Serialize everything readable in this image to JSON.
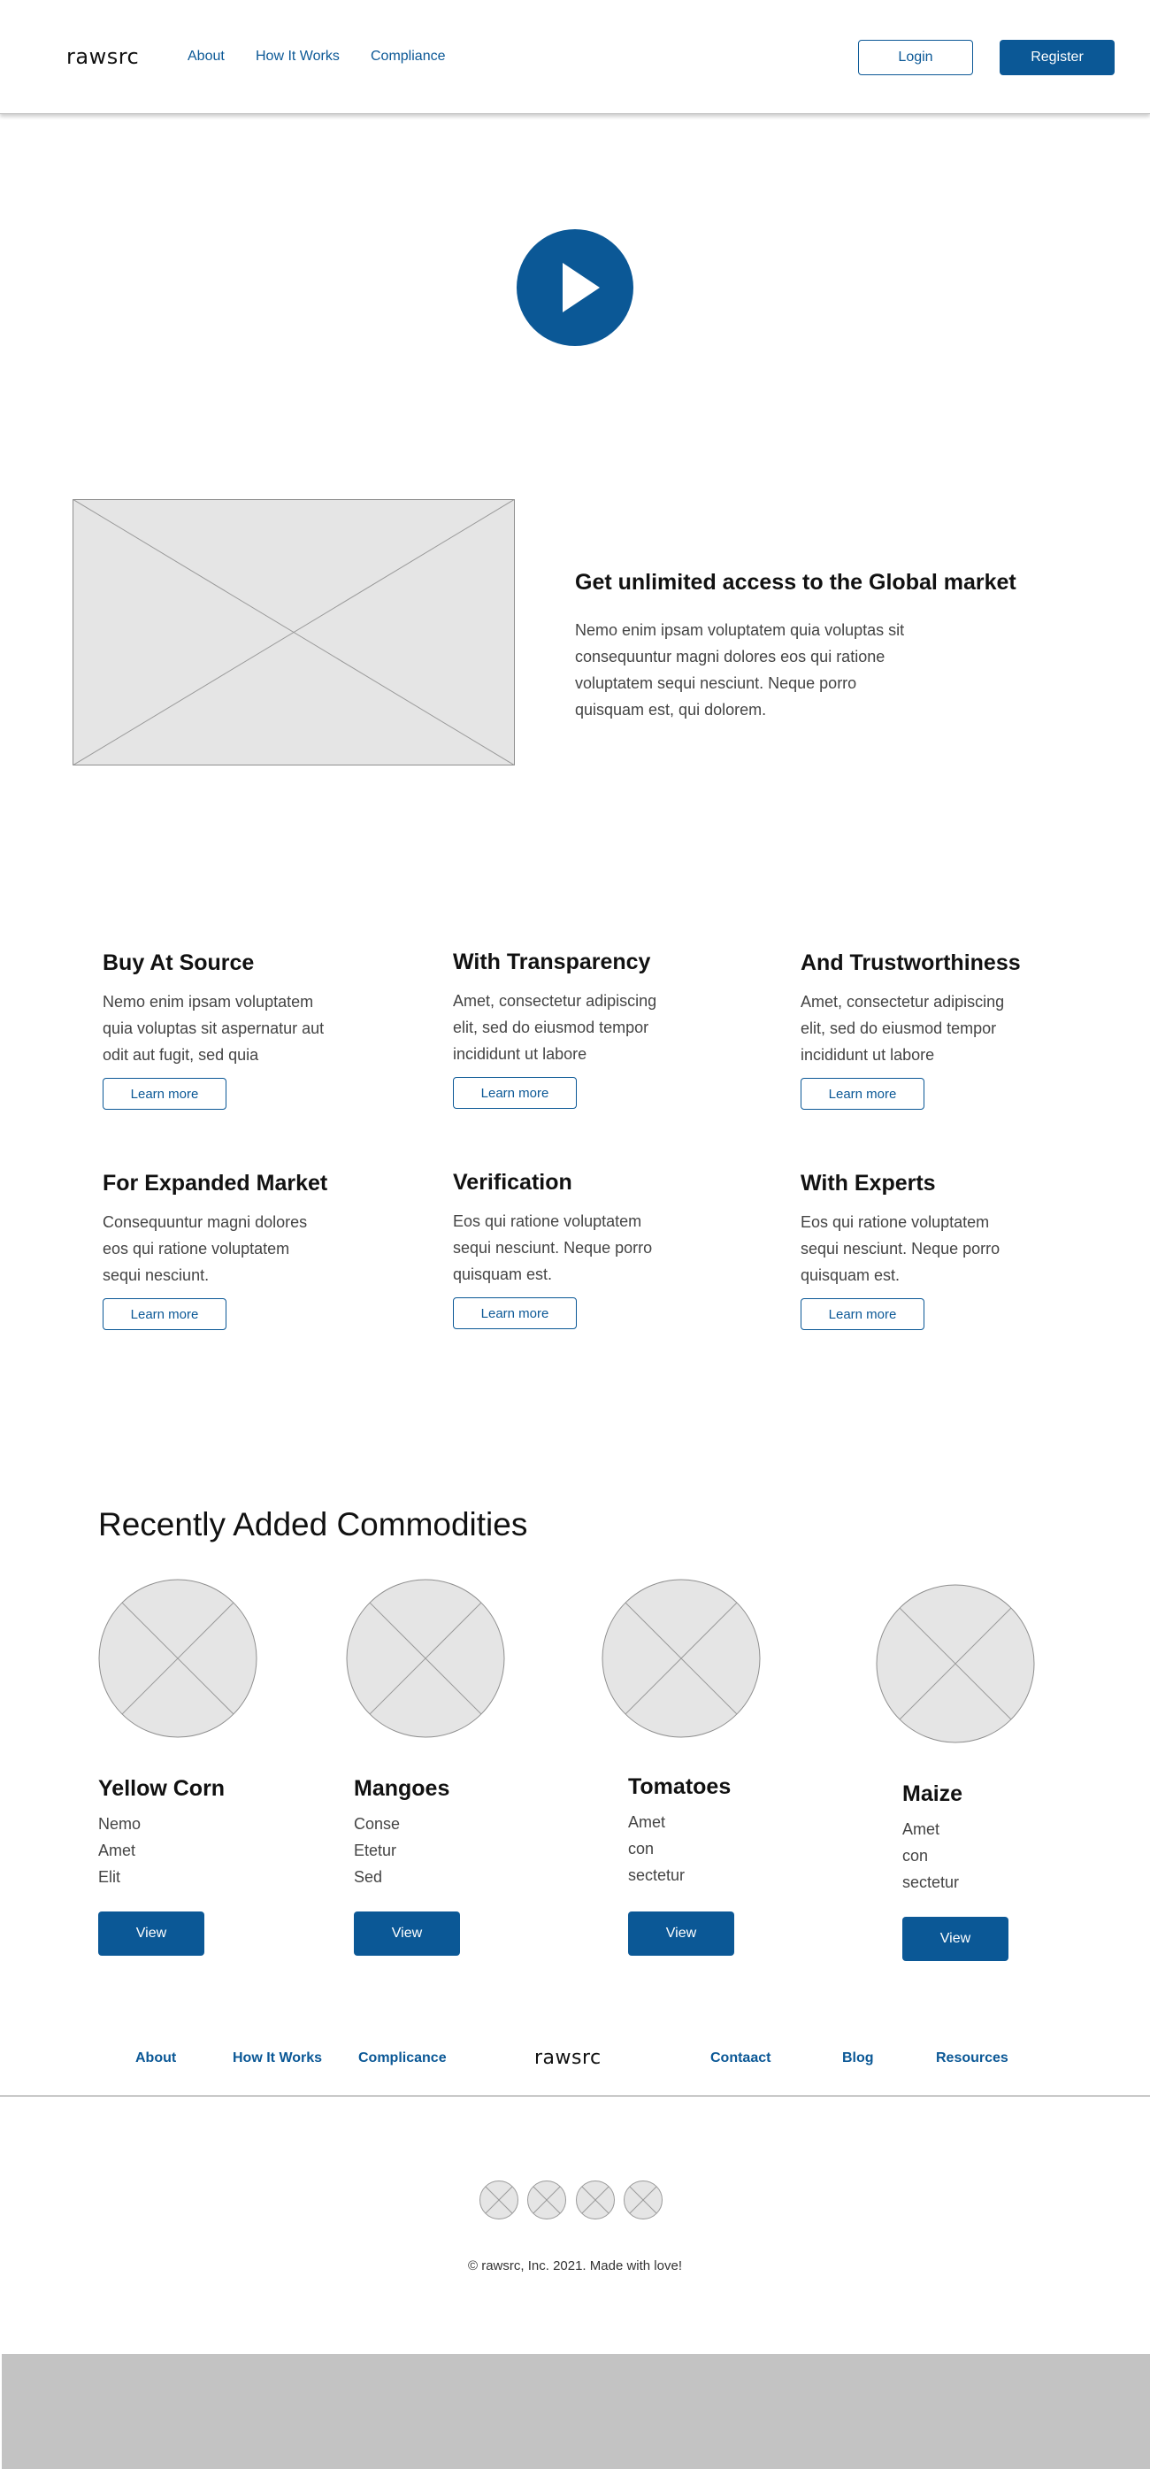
{
  "header": {
    "logo": "rawsrc",
    "nav": [
      "About",
      "How It Works",
      "Compliance"
    ],
    "login_label": "Login",
    "register_label": "Register"
  },
  "hero": {
    "play_icon": "play-icon",
    "feature_heading": "Get unlimited access to the Global market",
    "feature_text": [
      "Nemo enim ipsam voluptatem quia voluptas sit",
      "consequuntur magni dolores eos qui ratione",
      "voluptatem sequi nesciunt. Neque porro",
      "quisquam est, qui dolorem."
    ]
  },
  "features": [
    {
      "title": "Buy At Source",
      "lines": [
        "Nemo enim ipsam voluptatem",
        "quia voluptas sit aspernatur aut",
        "odit aut fugit, sed quia"
      ],
      "button": "Learn more"
    },
    {
      "title": "With Transparency",
      "lines": [
        "Amet, consectetur adipiscing",
        "elit, sed do eiusmod tempor",
        "incididunt ut labore"
      ],
      "button": "Learn more"
    },
    {
      "title": "And Trustworthiness",
      "lines": [
        "Amet, consectetur adipiscing",
        "elit, sed do eiusmod tempor",
        "incididunt ut labore"
      ],
      "button": "Learn more"
    },
    {
      "title": "For Expanded Market",
      "lines": [
        "Consequuntur magni dolores",
        "eos qui ratione voluptatem",
        "sequi nesciunt."
      ],
      "button": "Learn more"
    },
    {
      "title": "Verification",
      "lines": [
        "Eos qui ratione voluptatem",
        "sequi nesciunt. Neque porro",
        "quisquam est."
      ],
      "button": "Learn more"
    },
    {
      "title": "With Experts",
      "lines": [
        "Eos qui ratione voluptatem",
        "sequi nesciunt. Neque porro",
        "quisquam est."
      ],
      "button": "Learn more"
    }
  ],
  "commodities": {
    "title": "Recently Added Commodities",
    "items": [
      {
        "name": "Yellow Corn",
        "lines": [
          "Nemo",
          "Amet",
          "Elit"
        ],
        "button": "View"
      },
      {
        "name": "Mangoes",
        "lines": [
          "Conse",
          "Etetur",
          "Sed"
        ],
        "button": "View"
      },
      {
        "name": "Tomatoes",
        "lines": [
          "Amet",
          "con",
          "sectetur"
        ],
        "button": "View"
      },
      {
        "name": "Maize",
        "lines": [
          "Amet",
          "con",
          "sectetur"
        ],
        "button": "View"
      }
    ]
  },
  "footer": {
    "left_links": [
      "About",
      "How It Works",
      "Complicance"
    ],
    "logo": "rawsrc",
    "right_links": [
      "Contaact",
      "Blog",
      "Resources"
    ],
    "copyright": "© rawsrc, Inc. 2021. Made with love!"
  },
  "colors": {
    "accent": "#0b5896",
    "placeholder": "#e5e5e5",
    "footer_band": "#c3c3c3"
  }
}
